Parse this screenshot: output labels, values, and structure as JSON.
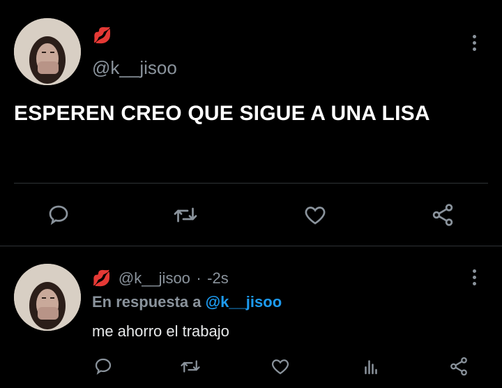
{
  "tweet": {
    "emoji": "💋",
    "handle": "@k__jisoo",
    "text": "ESPEREN CREO QUE SIGUE A UNA LISA"
  },
  "reply": {
    "emoji": "💋",
    "handle": "@k__jisoo",
    "separator": "·",
    "time": "-2s",
    "reply_prefix": "En respuesta a",
    "reply_mention": "@k__jisoo",
    "text": "me ahorro el trabajo"
  },
  "icons": {
    "more": "more-vertical-icon",
    "reply": "comment-icon",
    "retweet": "retweet-icon",
    "like": "heart-icon",
    "share": "share-icon",
    "stats": "bar-chart-icon"
  },
  "colors": {
    "background": "#000000",
    "muted": "#8a939c",
    "mention": "#1d9bf0",
    "divider": "#2f3336"
  }
}
